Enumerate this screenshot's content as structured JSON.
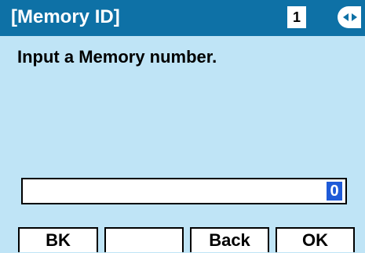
{
  "header": {
    "title": "[Memory ID]",
    "page_number": "1",
    "nav_icon": "left-right-arrows-icon"
  },
  "main": {
    "prompt": "Input a Memory number.",
    "input_value": "0"
  },
  "softkeys": [
    {
      "label": "BK"
    },
    {
      "label": ""
    },
    {
      "label": "Back"
    },
    {
      "label": "OK"
    }
  ],
  "colors": {
    "header_bg": "#0e71a6",
    "content_bg": "#bfe4f6",
    "cursor_bg": "#1f5bd8"
  }
}
